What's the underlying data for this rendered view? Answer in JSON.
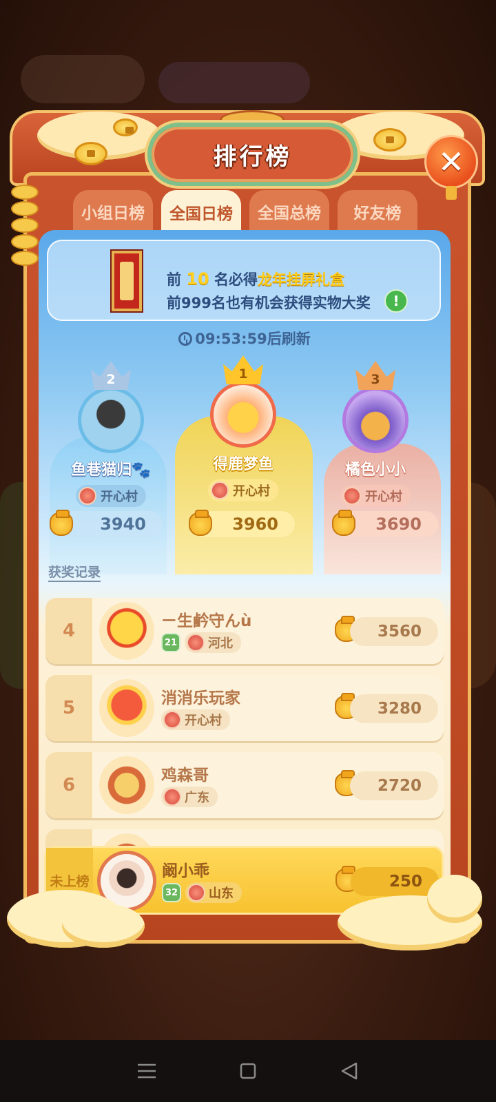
{
  "title": "排行榜",
  "tabs": [
    {
      "label": "小组日榜",
      "active": false
    },
    {
      "label": "全国日榜",
      "active": true
    },
    {
      "label": "全国总榜",
      "active": false
    },
    {
      "label": "好友榜",
      "active": false
    }
  ],
  "banner": {
    "line1_prefix": "前",
    "line1_number": "10",
    "line1_mid": "名必得",
    "line1_prize": "龙年挂屏礼盒",
    "line2": "前999名也有机会获得实物大奖"
  },
  "timer_text": "09:53:59后刷新",
  "prize_record_link": "获奖记录",
  "podium": [
    {
      "rank": "2",
      "name": "鱼巷猫归🐾",
      "region": "开心村",
      "score": "3940"
    },
    {
      "rank": "1",
      "name": "得鹿梦鱼",
      "region": "开心村",
      "score": "3960"
    },
    {
      "rank": "3",
      "name": "橘色小小",
      "region": "开心村",
      "score": "3690"
    }
  ],
  "rows": [
    {
      "rank": "4",
      "name": "ㄧ生鹶守んù",
      "level": "21",
      "region": "河北",
      "score": "3560"
    },
    {
      "rank": "5",
      "name": "消消乐玩家",
      "level": "",
      "region": "开心村",
      "score": "3280"
    },
    {
      "rank": "6",
      "name": "鸡森哥",
      "level": "",
      "region": "广东",
      "score": "2720"
    }
  ],
  "my_row": {
    "rank": "未上榜",
    "name": "阚小乖",
    "level": "32",
    "region": "山东",
    "score": "250"
  },
  "colors": {
    "frame_orange": "#c9532c",
    "tab_active_text": "#c0562c",
    "highlight_yellow": "#ffd020",
    "rank_text": "#d28a52"
  }
}
